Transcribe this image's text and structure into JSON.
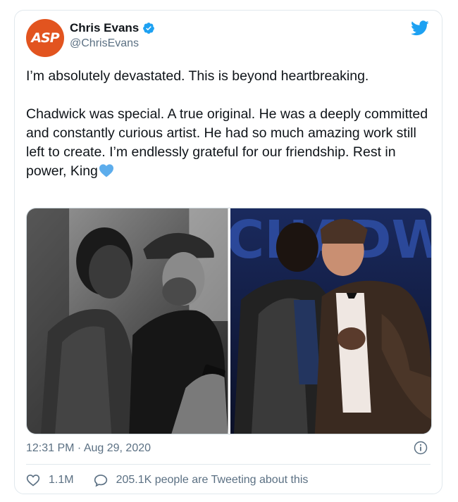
{
  "author": {
    "avatar_text": "ASP",
    "name": "Chris Evans",
    "handle": "@ChrisEvans",
    "verified": true
  },
  "tweet": {
    "text": "I’m absolutely devastated. This is beyond heartbreaking.\n\nChadwick was special. A true original. He was a deeply committed and constantly curious artist. He had so much amazing work still left to create. I’m endlessly grateful for our friendship. Rest in power, King",
    "emoji": "blue-heart",
    "timestamp": "12:31 PM · Aug 29, 2020"
  },
  "media": {
    "count": 2,
    "photos": [
      {
        "style": "black-and-white"
      },
      {
        "style": "color",
        "backdrop_text": "CHADWICK"
      }
    ]
  },
  "stats": {
    "likes": "1.1M",
    "conversation": "205.1K people are Tweeting about this"
  },
  "colors": {
    "twitter_blue": "#1da1f2",
    "secondary_text": "#5b7083",
    "avatar_bg": "#e2541f"
  }
}
